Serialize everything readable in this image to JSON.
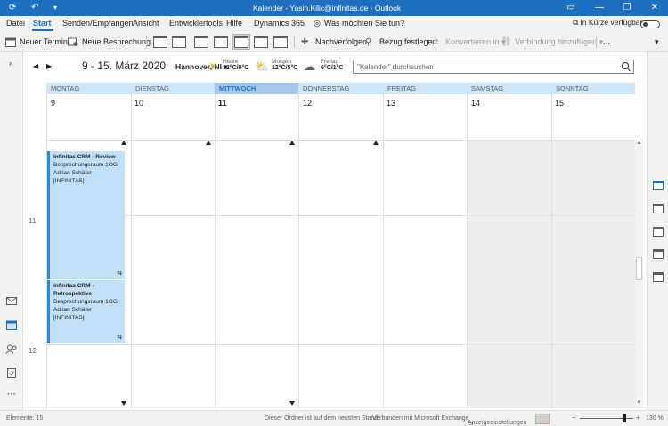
{
  "titlebar": {
    "title": "Kalender - Yasin.Kilic@infinitas.de  -  Outlook",
    "sync_icon": "sync-icon",
    "undo_icon": "undo-icon",
    "dropdown_icon": "chevron-down-icon"
  },
  "menu": {
    "items": [
      "Datei",
      "Start",
      "Senden/Empfangen",
      "Ansicht",
      "Entwicklertools",
      "Hilfe",
      "Dynamics 365"
    ],
    "active": "Start",
    "tell_me": "Was möchten Sie tun?",
    "coming_soon": "In Kürze verfügbar"
  },
  "ribbon": {
    "new_appointment": "Neuer Termin",
    "new_meeting": "Neue Besprechung",
    "track": "Nachverfolgen",
    "set_regarding": "Bezug festlegen",
    "convert": "Konvertieren in",
    "add_connection": "Verbindung hinzufügen",
    "more": "..."
  },
  "calendar": {
    "date_range": "9 - 15. März 2020",
    "location": "Hannover, NI",
    "weather": [
      {
        "label": "Heute",
        "temp": "12°C/9°C",
        "icon": "sun-icon"
      },
      {
        "label": "Morgen",
        "temp": "12°C/5°C",
        "icon": "partly-sunny-icon"
      },
      {
        "label": "Freitag",
        "temp": "6°C/1°C",
        "icon": "snow-cloud-icon"
      }
    ],
    "search_placeholder": "\"Kalender\" durchsuchen",
    "days": [
      {
        "name": "MONTAG",
        "num": "9"
      },
      {
        "name": "DIENSTAG",
        "num": "10"
      },
      {
        "name": "MITTWOCH",
        "num": "11"
      },
      {
        "name": "DONNERSTAG",
        "num": "12"
      },
      {
        "name": "FREITAG",
        "num": "13"
      },
      {
        "name": "SAMSTAG",
        "num": "14"
      },
      {
        "name": "SONNTAG",
        "num": "15"
      }
    ],
    "today_index": 2,
    "hours": [
      "11",
      "12"
    ],
    "events": [
      {
        "title": "infinitas CRM - Review",
        "room": "Besprechungsraum 1OG",
        "organizer": "Adrian Schäfer [INFINITAS]"
      },
      {
        "title": "infinitas CRM - Retrospektive",
        "room": "Besprechungsraum 1OG",
        "organizer": "Adrian Schäfer [INFINITAS]"
      }
    ]
  },
  "status": {
    "items": "Elemente: 15",
    "up_to_date": "Dieser Ordner ist auf dem neusten Stand.",
    "connected": "Verbunden mit Microsoft Exchange",
    "display_settings": "Anzeigeeinstellungen",
    "zoom": "130 %"
  },
  "colors": {
    "accent": "#1e6fc1",
    "day_header": "#cce4f7",
    "event_fill": "#bfe0f8",
    "event_border": "#2b88d8"
  }
}
